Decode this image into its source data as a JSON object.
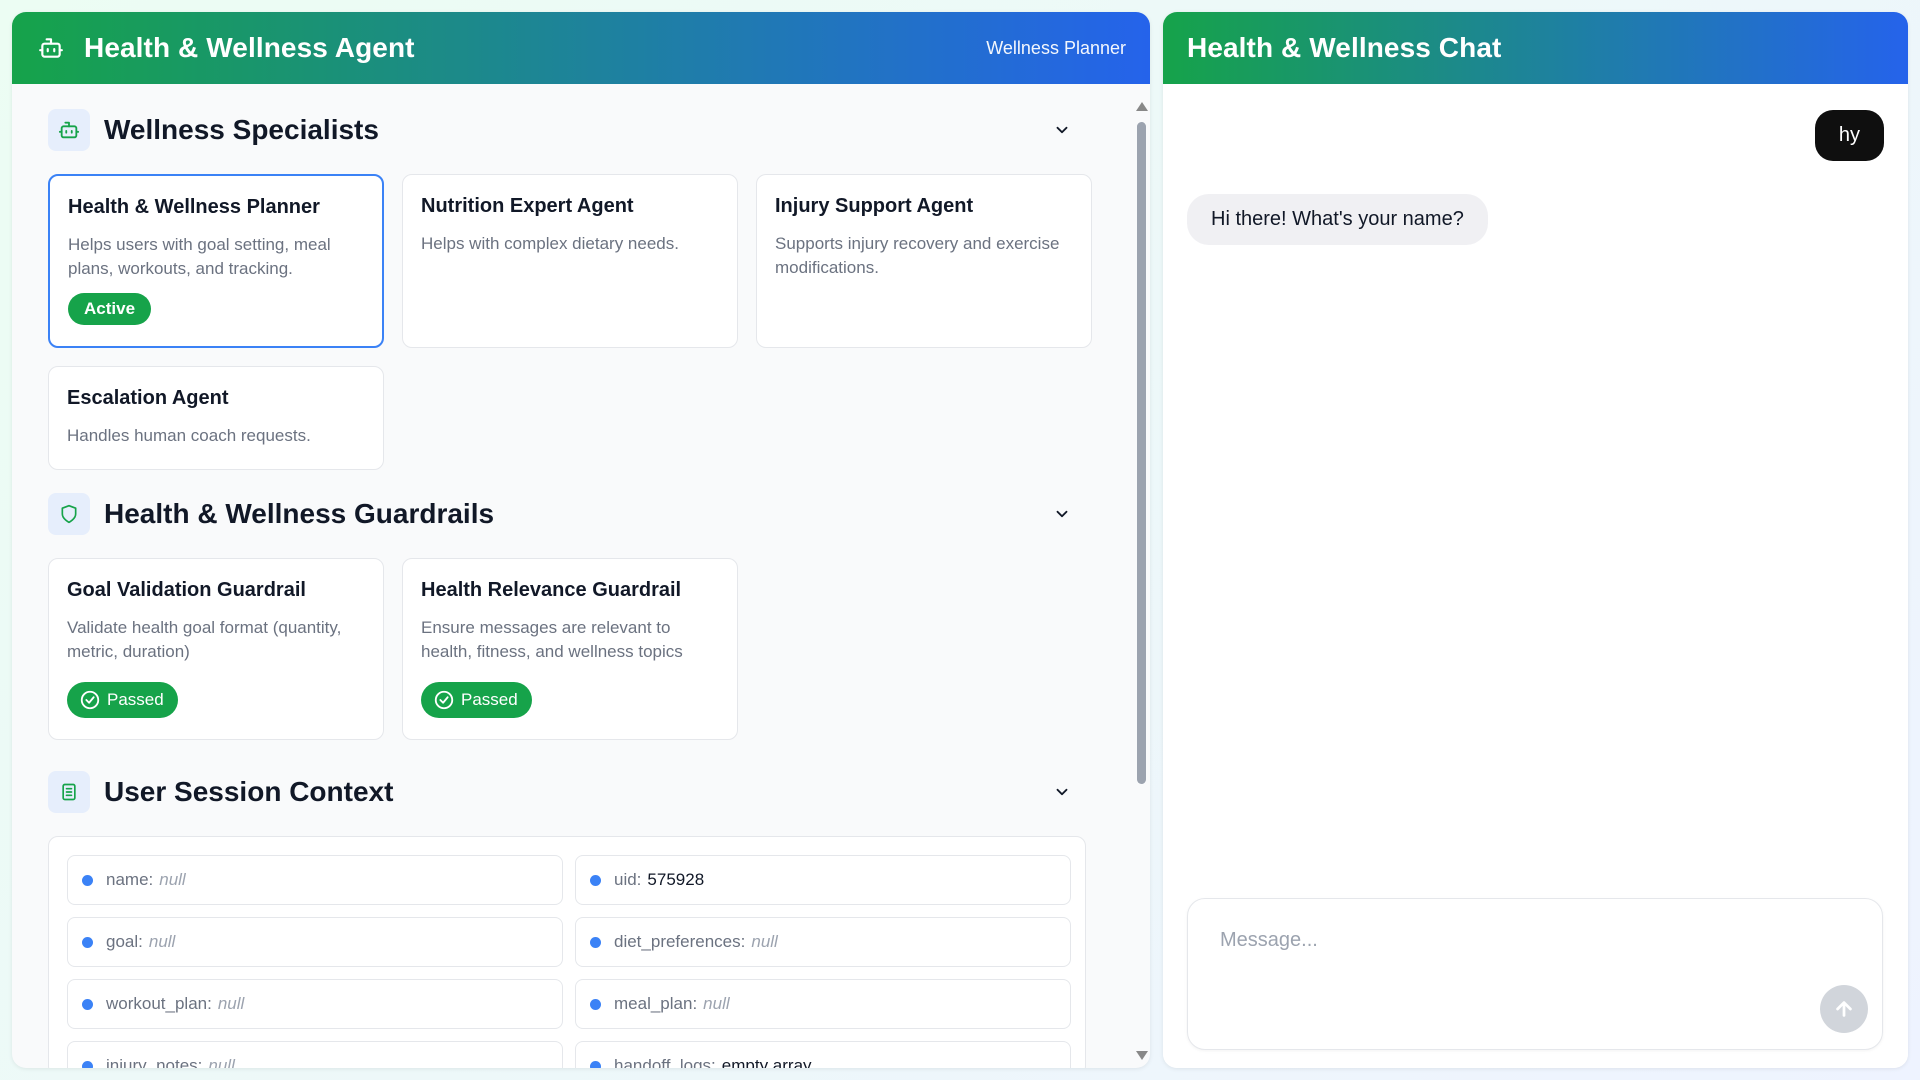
{
  "left_header": {
    "title": "Health & Wellness Agent",
    "subtitle": "Wellness Planner",
    "icon": "robot-icon"
  },
  "specialists": {
    "title": "Wellness Specialists",
    "icon": "robot-icon",
    "agents": [
      {
        "name": "Health & Wellness Planner",
        "description": "Helps users with goal setting, meal plans, workouts, and tracking.",
        "badge": "Active"
      },
      {
        "name": "Nutrition Expert Agent",
        "description": "Helps with complex dietary needs."
      },
      {
        "name": "Injury Support Agent",
        "description": "Supports injury recovery and exercise modifications."
      },
      {
        "name": "Escalation Agent",
        "description": "Handles human coach requests."
      }
    ]
  },
  "guardrails": {
    "title": "Health & Wellness Guardrails",
    "icon": "shield-icon",
    "items": [
      {
        "name": "Goal Validation Guardrail",
        "description": "Validate health goal format (quantity, metric, duration)",
        "status": "Passed"
      },
      {
        "name": "Health Relevance Guardrail",
        "description": "Ensure messages are relevant to health, fitness, and wellness topics",
        "status": "Passed"
      }
    ]
  },
  "context": {
    "title": "User Session Context",
    "icon": "document-icon",
    "fields": [
      {
        "key": "name:",
        "value": "null",
        "is_null": true
      },
      {
        "key": "uid:",
        "value": "575928",
        "is_null": false
      },
      {
        "key": "goal:",
        "value": "null",
        "is_null": true
      },
      {
        "key": "diet_preferences:",
        "value": "null",
        "is_null": true
      },
      {
        "key": "workout_plan:",
        "value": "null",
        "is_null": true
      },
      {
        "key": "meal_plan:",
        "value": "null",
        "is_null": true
      },
      {
        "key": "injury_notes:",
        "value": "null",
        "is_null": true
      },
      {
        "key": "handoff_logs:",
        "value": "empty array",
        "is_null": false
      }
    ]
  },
  "chat": {
    "title": "Health & Wellness Chat",
    "messages": [
      {
        "role": "user",
        "text": "hy"
      },
      {
        "role": "assistant",
        "text": "Hi there! What's your name?"
      }
    ],
    "input_placeholder": "Message...",
    "send_icon": "arrow-up-icon"
  },
  "colors": {
    "green": "#16a34a",
    "blue": "#2563eb",
    "active_border": "#3b82f6"
  }
}
